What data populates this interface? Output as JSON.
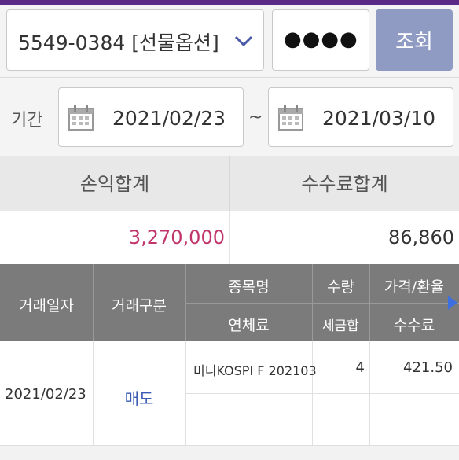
{
  "query": {
    "account": "5549-0384 [선물옵션]",
    "password_mask": "●●●●",
    "search_label": "조회"
  },
  "period": {
    "label": "기간",
    "start_date": "2021/02/23",
    "separator": "~",
    "end_date": "2021/03/10"
  },
  "summary": {
    "pnl_label": "손익합계",
    "fee_label": "수수료합계",
    "pnl_value": "3,270,000",
    "fee_value": "86,860"
  },
  "table": {
    "headers": {
      "trade_date": "거래일자",
      "trade_type": "거래구분",
      "item_name": "종목명",
      "quantity": "수량",
      "price_rate": "가격/환율",
      "late_fee": "연체료",
      "tax_total": "세금합",
      "commission": "수수료"
    },
    "rows": [
      {
        "trade_date": "2021/02/23",
        "trade_type": "매도",
        "item_name": "미니KOSPI F 202103",
        "quantity": "4",
        "price": "421.50"
      }
    ]
  },
  "colors": {
    "accent_purple": "#5b2a86",
    "search_button": "#8f9bc3",
    "pnl_value": "#c0356b",
    "sell_text": "#3b5bb5",
    "header_bg": "#7b7b7b",
    "scroll_arrow": "#3d6fe0"
  },
  "icons": {
    "account_dropdown": "chevron-down-icon",
    "date_picker": "calendar-icon",
    "scroll_right": "triangle-right-icon"
  }
}
